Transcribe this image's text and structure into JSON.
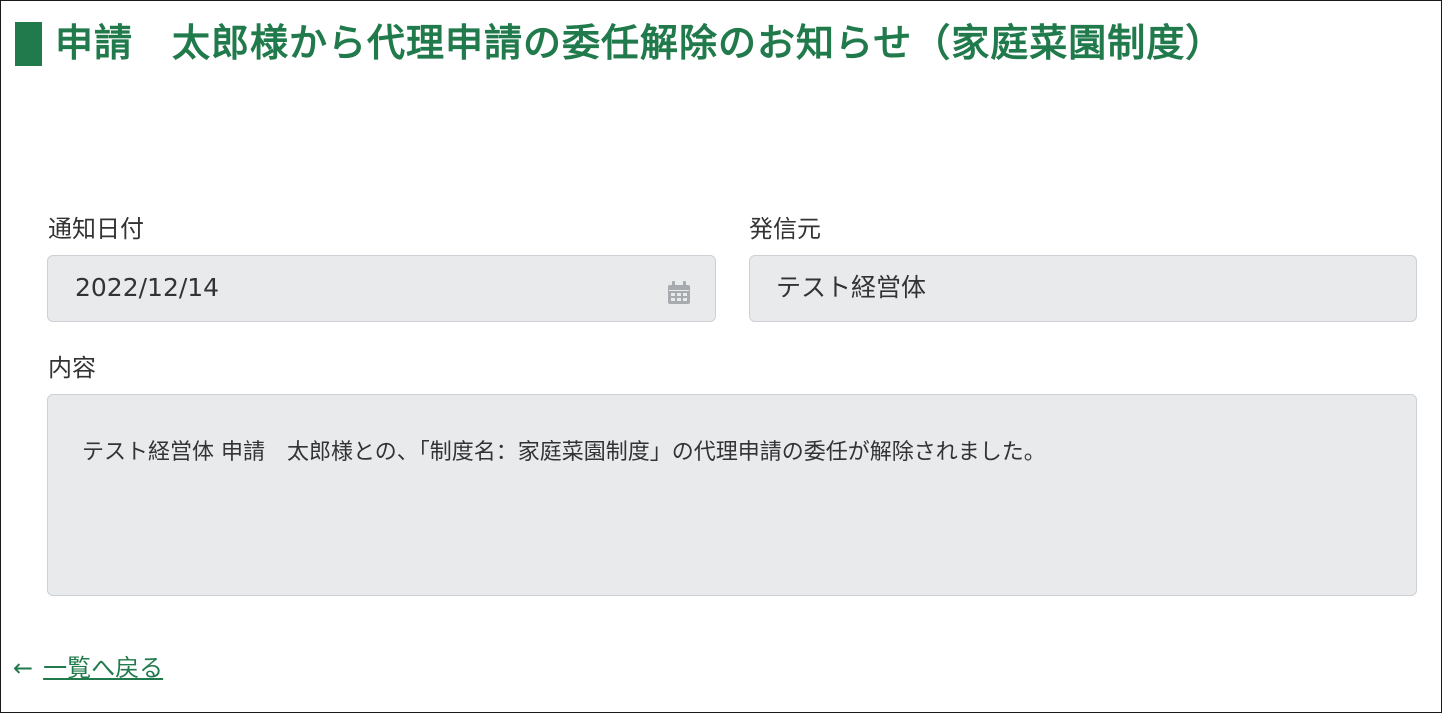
{
  "page": {
    "title": "申請　太郎様から代理申請の委任解除のお知らせ（家庭菜園制度）"
  },
  "fields": {
    "notification_date": {
      "label": "通知日付",
      "value": "2022/12/14",
      "icon": "calendar-icon"
    },
    "sender": {
      "label": "発信元",
      "value": "テスト経営体"
    },
    "content": {
      "label": "内容",
      "value": "テスト経営体 申請　太郎様との、「制度名：家庭菜園制度」の代理申請の委任が解除されました。"
    }
  },
  "navigation": {
    "back_arrow": "←",
    "back_label": "一覧へ戻る"
  },
  "colors": {
    "accent": "#217a4b",
    "field_background": "#e9eaec",
    "field_border": "#cdd1d5",
    "text": "#333333"
  }
}
